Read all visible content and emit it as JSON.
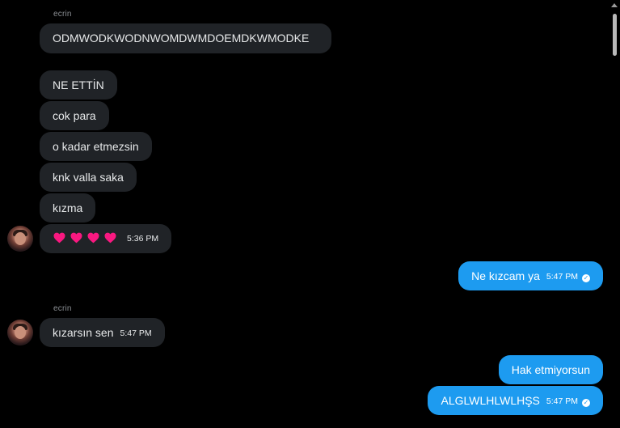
{
  "conversation": {
    "group1": {
      "sender": "ecrin",
      "messages": [
        "ODMWODKWODNWOMDWMDOEMDKWMODKE",
        "NE ETTİN",
        "cok para",
        "o kadar etmezsin",
        "knk valla saka",
        "kızma"
      ],
      "hearts_count": 4,
      "hearts_time": "5:36 PM"
    },
    "out1": {
      "text": "Ne kızcam ya",
      "time": "5:47 PM"
    },
    "group2": {
      "sender": "ecrin",
      "message": "kızarsın sen",
      "time": "5:47 PM"
    },
    "out2": {
      "text": "Hak etmiyorsun"
    },
    "out3": {
      "text": "ALGLWLHLWLHŞS",
      "time": "5:47 PM"
    }
  },
  "colors": {
    "background": "#000000",
    "incoming_bubble": "#202327",
    "outgoing_bubble": "#1d9bf0",
    "heart": "#f91880"
  },
  "icons": {
    "heart": "heart-icon",
    "sent_check": "check-circle-icon",
    "avatar": "avatar"
  }
}
